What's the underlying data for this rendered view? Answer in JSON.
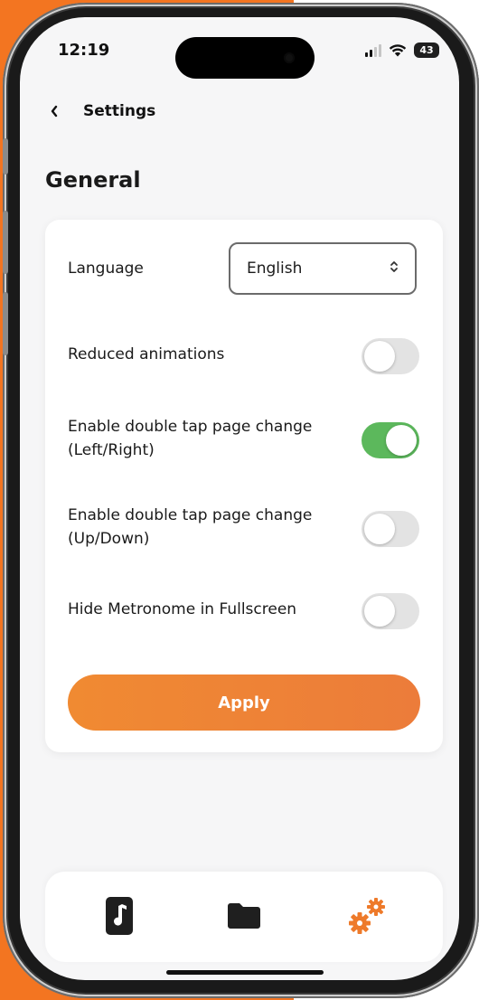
{
  "status": {
    "time": "12:19",
    "battery": "43"
  },
  "nav": {
    "back_icon": "chevron-left-icon",
    "title": "Settings"
  },
  "section": {
    "title": "General"
  },
  "settings": {
    "language": {
      "label": "Language",
      "value": "English"
    },
    "reduced_animations": {
      "label": "Reduced animations",
      "on": false
    },
    "double_tap_lr": {
      "label_line1": "Enable double tap page change",
      "label_line2": "(Left/Right)",
      "on": true
    },
    "double_tap_ud": {
      "label_line1": "Enable double tap page change",
      "label_line2": "(Up/Down)",
      "on": false
    },
    "hide_metronome": {
      "label": "Hide Metronome in Fullscreen",
      "on": false
    },
    "apply_label": "Apply"
  },
  "tabbar": {
    "items": [
      {
        "name": "music-note-icon"
      },
      {
        "name": "folder-icon"
      },
      {
        "name": "settings-gears-icon",
        "active": true
      }
    ]
  },
  "colors": {
    "accent": "#f08a32",
    "toggle_on": "#5cb85c",
    "background_left": "#f37521"
  }
}
